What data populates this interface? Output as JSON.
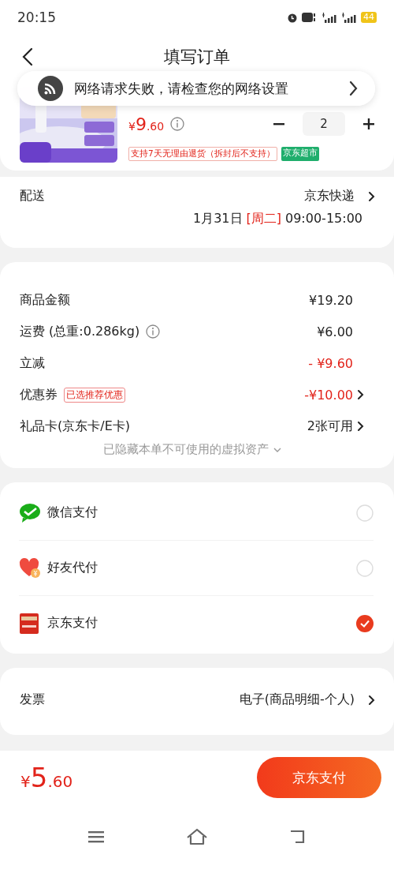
{
  "status_bar": {
    "time": "20:15",
    "battery": "44"
  },
  "header": {
    "title": "填写订单"
  },
  "toast": {
    "message": "网络请求失败，请检查您的网络设置"
  },
  "product": {
    "price": {
      "currency": "¥",
      "integer": "9",
      "decimal": ".60"
    },
    "quantity": "2",
    "tags": [
      {
        "text": "支持7天无理由退货（拆封后不支持）",
        "kind": "outline"
      },
      {
        "text": "京东超市",
        "kind": "filled"
      }
    ]
  },
  "delivery": {
    "label": "配送",
    "carrier": "京东快递",
    "date": "1月31日",
    "weekday": "[周二]",
    "time_range": "09:00-15:00"
  },
  "summary": {
    "rows": [
      {
        "label": "商品金额",
        "value": "¥19.20",
        "color": "#222222",
        "info": false,
        "chevron": false
      },
      {
        "label": "运费 (总重:0.286kg)",
        "value": "¥6.00",
        "color": "#222222",
        "info": true,
        "chevron": false
      },
      {
        "label": "立减",
        "value": "- ¥9.60",
        "color": "#e2231a",
        "info": false,
        "chevron": false
      },
      {
        "label": "优惠券",
        "tag": "已选推荐优惠",
        "value": "-¥10.00",
        "color": "#e2231a",
        "info": false,
        "chevron": true
      },
      {
        "label": "礼品卡(京东卡/E卡)",
        "value": "2张可用",
        "color": "#222222",
        "info": false,
        "chevron": true
      }
    ],
    "note": "已隐藏本单不可使用的虚拟资产"
  },
  "payment_methods": [
    {
      "name": "微信支付",
      "kind": "wechat",
      "selected": false
    },
    {
      "name": "好友代付",
      "kind": "friend",
      "selected": false
    },
    {
      "name": "京东支付",
      "kind": "jdpay",
      "selected": true
    }
  ],
  "invoice": {
    "label": "发票",
    "value": "电子(商品明细-个人)"
  },
  "footer": {
    "total": {
      "currency": "¥",
      "integer": "5",
      "decimal": ".60"
    },
    "pay_button": "京东支付"
  }
}
